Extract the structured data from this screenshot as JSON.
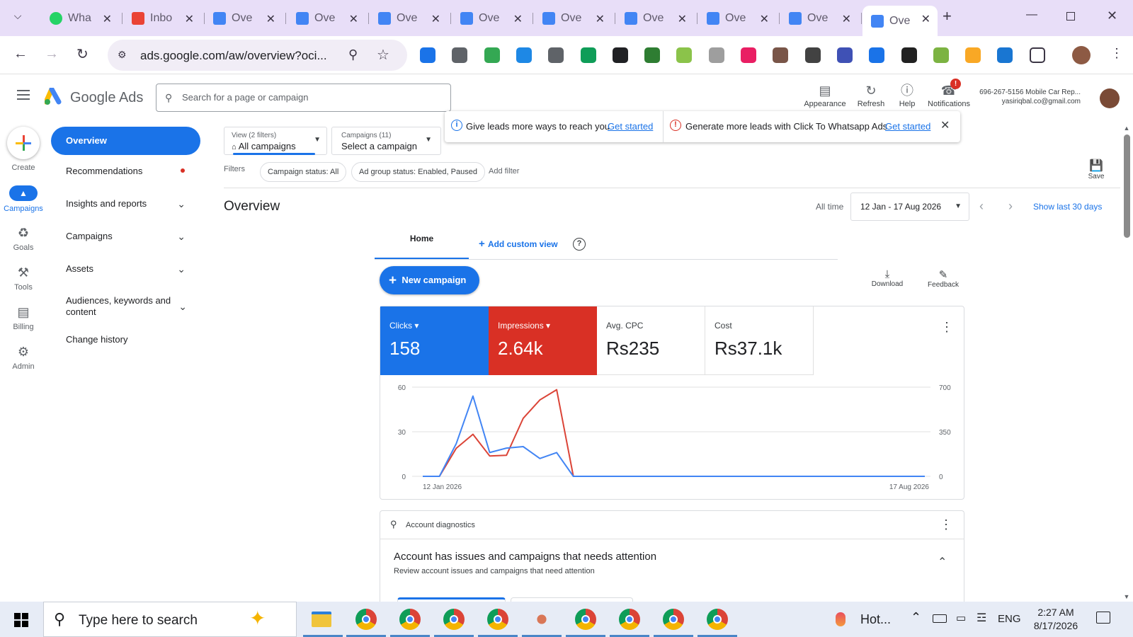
{
  "browser": {
    "tabs": [
      {
        "title": "Wha",
        "icon": "whatsapp-icon"
      },
      {
        "title": "Inbo",
        "icon": "gmail-icon"
      },
      {
        "title": "Ove",
        "icon": "google-ads-icon"
      },
      {
        "title": "Ove",
        "icon": "google-ads-icon"
      },
      {
        "title": "Ove",
        "icon": "google-ads-icon"
      },
      {
        "title": "Ove",
        "icon": "google-ads-icon"
      },
      {
        "title": "Ove",
        "icon": "google-ads-icon"
      },
      {
        "title": "Ove",
        "icon": "google-ads-icon"
      },
      {
        "title": "Ove",
        "icon": "google-ads-icon"
      },
      {
        "title": "Ove",
        "icon": "google-ads-icon"
      },
      {
        "title": "Ove",
        "icon": "google-ads-icon"
      }
    ],
    "url": "ads.google.com/aw/overview?oci..."
  },
  "app": {
    "product": "Google Ads",
    "search_placeholder": "Search for a page or campaign",
    "header_buttons": {
      "appearance": "Appearance",
      "refresh": "Refresh",
      "help": "Help",
      "notifications": "Notifications",
      "notif_badge": "!"
    },
    "account": {
      "name": "696-267-5156 Mobile Car Rep...",
      "email": "yasiriqbal.co@gmail.com"
    }
  },
  "rail": {
    "create": "Create",
    "campaigns": "Campaigns",
    "goals": "Goals",
    "tools": "Tools",
    "billing": "Billing",
    "admin": "Admin"
  },
  "nav": {
    "overview": "Overview",
    "recommendations": "Recommendations",
    "insights": "Insights and reports",
    "campaigns": "Campaigns",
    "assets": "Assets",
    "audiences": "Audiences, keywords and content",
    "history": "Change history"
  },
  "selectors": {
    "view_label": "View (2 filters)",
    "view_value": "All campaigns",
    "campaigns_label": "Campaigns (11)",
    "campaigns_value": "Select a campaign"
  },
  "banners": {
    "b1_text": "Give leads more ways to reach you",
    "b1_link": "Get started",
    "b2_text": "Generate more leads with Click To Whatsapp Ads",
    "b2_link": "Get started"
  },
  "filters": {
    "label": "Filters",
    "chip1": "Campaign status: All",
    "chip2": "Ad group status: Enabled, Paused",
    "add": "Add filter",
    "save": "Save"
  },
  "page": {
    "title": "Overview",
    "range_label": "All time",
    "date_range": "12 Jan - 17 Aug 2026",
    "show_last": "Show last 30 days",
    "tab_home": "Home",
    "add_custom_view": "Add custom view",
    "new_campaign": "New campaign",
    "download": "Download",
    "feedback": "Feedback"
  },
  "metrics": [
    {
      "label": "Clicks",
      "value": "158",
      "color": "#1a73e8"
    },
    {
      "label": "Impressions",
      "value": "2.64k",
      "color": "#d93025"
    },
    {
      "label": "Avg. CPC",
      "value": "Rs235"
    },
    {
      "label": "Cost",
      "value": "Rs37.1k"
    }
  ],
  "chart_data": {
    "type": "line",
    "x_start": "12 Jan 2026",
    "x_end": "17 Aug 2026",
    "left_ticks": [
      "60",
      "30",
      "0"
    ],
    "right_ticks": [
      "700",
      "350",
      "0"
    ],
    "ylim_left": [
      0,
      60
    ],
    "ylim_right": [
      0,
      700
    ],
    "series": [
      {
        "name": "Clicks",
        "axis": "left",
        "color": "#4285f4",
        "values": [
          0,
          0,
          22,
          54,
          16,
          19,
          20,
          12,
          16,
          0,
          0,
          0,
          0,
          0,
          0,
          0,
          0,
          0,
          0,
          0,
          0,
          0,
          0,
          0,
          0,
          0,
          0,
          0,
          0,
          0,
          0
        ]
      },
      {
        "name": "Impressions",
        "axis": "right",
        "color": "#db4437",
        "values": [
          0,
          0,
          220,
          330,
          160,
          165,
          455,
          600,
          680,
          0,
          0,
          0,
          0,
          0,
          0,
          0,
          0,
          0,
          0,
          0,
          0,
          0,
          0,
          0,
          0,
          0,
          0,
          0,
          0,
          0,
          0
        ]
      }
    ]
  },
  "diagnostics": {
    "header": "Account diagnostics",
    "title": "Account has issues and campaigns that needs attention",
    "subtitle": "Review account issues and campaigns that need attention"
  },
  "taskbar": {
    "search_placeholder": "Type here to search",
    "weather": "Hot...",
    "lang": "ENG",
    "time": "2:27 AM",
    "date": "8/17/2026"
  }
}
